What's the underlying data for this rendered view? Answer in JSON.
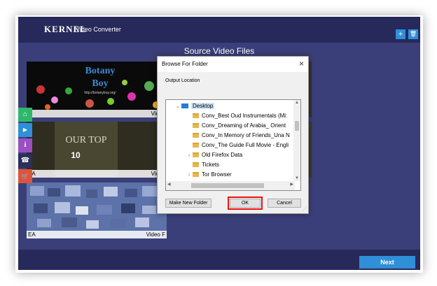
{
  "app": {
    "brand": "KERNEL",
    "product": "Video Converter",
    "section_title": "Source Video Files",
    "add_button": "+",
    "delete_button": "🗑",
    "next_button": "Next"
  },
  "thumbnails": [
    {
      "title_left": "",
      "title_right": "Video",
      "art_line1": "Botany",
      "art_line2": "Boy",
      "art_url": "http://botanyboy.org/"
    },
    {
      "title_left": "EA",
      "title_right": "Video",
      "art_line1": "OUR TOP",
      "art_line2": "10"
    },
    {
      "title_left": "EA",
      "title_right": "Video F"
    }
  ],
  "sidebar": [
    {
      "name": "home",
      "icon": "home-icon",
      "glyph": "⌂",
      "color": "#2fb86b"
    },
    {
      "name": "video",
      "icon": "video-icon",
      "glyph": "▶",
      "color": "#2f8fd8"
    },
    {
      "name": "info",
      "icon": "info-icon",
      "glyph": "i",
      "color": "#9b4fc2"
    },
    {
      "name": "phone",
      "icon": "phone-icon",
      "glyph": "☎",
      "color": "#2b2f5a"
    },
    {
      "name": "cart",
      "icon": "cart-icon",
      "glyph": "🛒",
      "color": "#e0533b"
    }
  ],
  "dialog": {
    "title": "Browse For Folder",
    "close": "×",
    "label": "Output Location",
    "tree": [
      {
        "label": "Desktop",
        "kind": "desktop",
        "chevron": "⌄",
        "selected": true,
        "indent": 0
      },
      {
        "label": "Conv_Best Oud Instrumentals (Mi:",
        "kind": "folder",
        "chevron": "",
        "indent": 1
      },
      {
        "label": "Conv_Dreaming of Arabia_ Orient",
        "kind": "folder",
        "chevron": "",
        "indent": 1
      },
      {
        "label": "Conv_In Memory of Friends_Una N",
        "kind": "folder",
        "chevron": "",
        "indent": 1
      },
      {
        "label": "Conv_The Guide Full Movie - Engli",
        "kind": "folder",
        "chevron": "",
        "indent": 1
      },
      {
        "label": "Old Firefox Data",
        "kind": "folder",
        "chevron": "›",
        "indent": 1
      },
      {
        "label": "Tickets",
        "kind": "folder",
        "chevron": "",
        "indent": 1
      },
      {
        "label": "Tor Browser",
        "kind": "folder",
        "chevron": "›",
        "indent": 1
      }
    ],
    "make_folder": "Make New Folder",
    "ok": "OK",
    "cancel": "Cancel"
  },
  "colors": {
    "app_bg": "#3b3f79",
    "titlebar": "#26295a",
    "accent": "#2f8fd8",
    "highlight": "#e11111"
  }
}
